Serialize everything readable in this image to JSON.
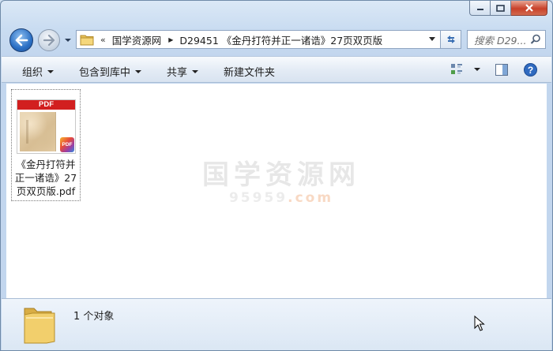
{
  "window": {
    "caption": {
      "minimize_icon": "minimize-icon",
      "maximize_icon": "maximize-icon",
      "close_icon": "close-icon"
    }
  },
  "navigation": {
    "back_icon": "back-arrow-icon",
    "forward_icon": "forward-arrow-icon",
    "recent_icon": "chevron-down-icon",
    "address": {
      "overflow_chevron": "«",
      "crumbs": [
        "国学资源网",
        "D29451 《金丹打符并正一诸诰》27页双页版"
      ]
    },
    "refresh_icon": "refresh-icon",
    "search": {
      "placeholder": "搜索 D29..."
    }
  },
  "toolbar": {
    "organize": "组织",
    "include_in_library": "包含到库中",
    "share": "共享",
    "new_folder": "新建文件夹",
    "view_icon": "view-options-icon",
    "preview_icon": "preview-pane-icon",
    "help_icon": "help-icon"
  },
  "files": [
    {
      "name": "《金丹打符并正一诸诰》27页双页版.pdf",
      "thumb_label": "PDF",
      "badge_label": "PDF"
    }
  ],
  "watermark": {
    "title": "国学资源网",
    "subtitle_main": "95959",
    "subtitle_tld": ".com"
  },
  "details": {
    "count_text": "1 个对象"
  },
  "colors": {
    "pdf_red": "#d21f1f",
    "window_frame": "#c9dcf1",
    "close_red": "#c8412a"
  }
}
